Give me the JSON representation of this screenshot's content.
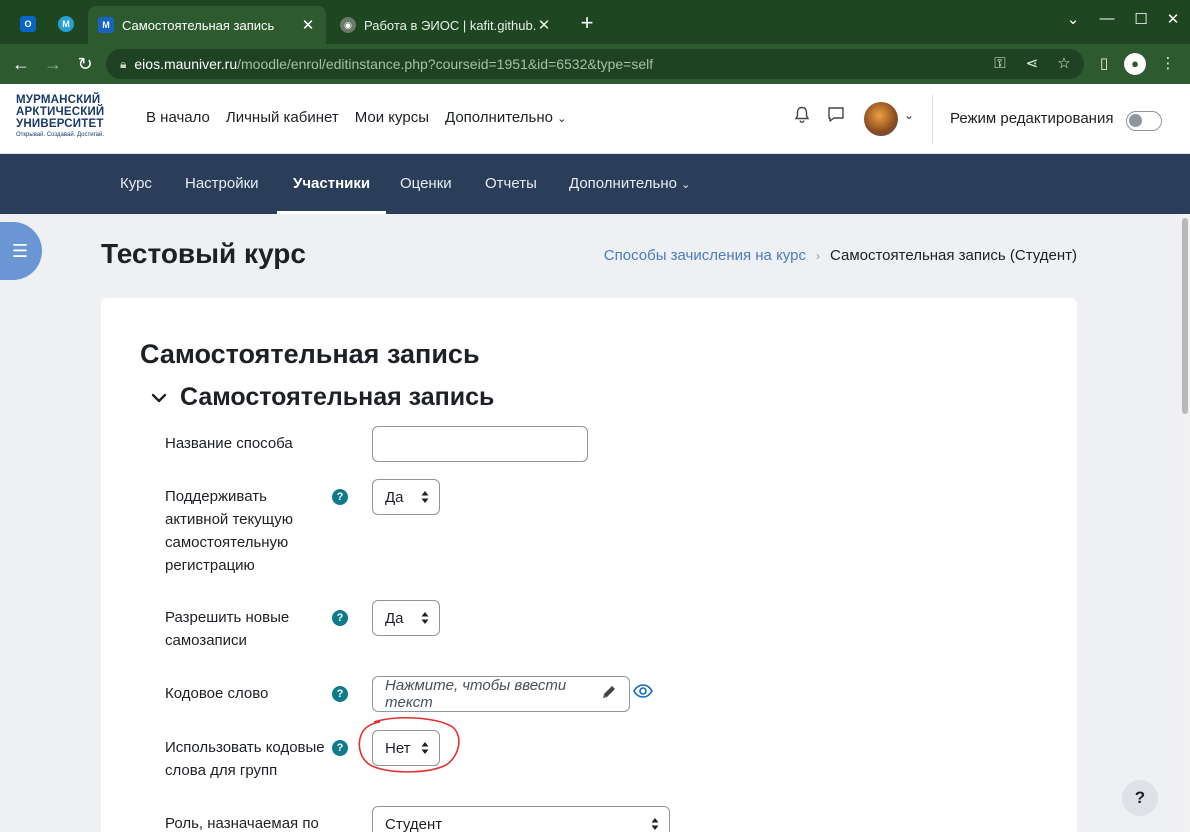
{
  "browser": {
    "tabs": [
      {
        "title": "Самостоятельная запись",
        "active": true
      },
      {
        "title": "Работа в ЭИОС | kafit.github.io",
        "active": false
      }
    ],
    "url_host": "eios.mauniver.ru",
    "url_path": "/moodle/enrol/editinstance.php?courseid=1951&id=6532&type=self",
    "colors": {
      "frame": "#1e4620",
      "toolbar": "#2d5a2e"
    }
  },
  "header": {
    "logo_line1": "МУРМАНСКИЙ",
    "logo_line2": "АРКТИЧЕСКИЙ",
    "logo_line3": "УНИВЕРСИТЕТ",
    "logo_tagline": "Открывай. Создавай. Достигай.",
    "nav": [
      "В начало",
      "Личный кабинет",
      "Мои курсы",
      "Дополнительно"
    ],
    "edit_mode_label": "Режим редактирования",
    "edit_mode_on": false
  },
  "secondary_nav": {
    "items": [
      "Курс",
      "Настройки",
      "Участники",
      "Оценки",
      "Отчеты",
      "Дополнительно"
    ],
    "active": "Участники"
  },
  "page": {
    "course_title": "Тестовый курс",
    "breadcrumb_link": "Способы зачисления на курс",
    "breadcrumb_current": "Самостоятельная запись (Студент)",
    "form_title": "Самостоятельная запись",
    "section_title": "Самостоятельная запись"
  },
  "form": {
    "method_name": {
      "label": "Название способа",
      "value": ""
    },
    "keep_active": {
      "label_lines": [
        "Поддерживать",
        "активной текущую",
        "самостоятельную",
        "регистрацию"
      ],
      "value": "Да"
    },
    "allow_new": {
      "label_lines": [
        "Разрешить новые",
        "самозаписи"
      ],
      "value": "Да"
    },
    "enrol_key": {
      "label": "Кодовое слово",
      "placeholder": "Нажмите, чтобы ввести текст"
    },
    "group_key": {
      "label_lines": [
        "Использовать кодовые",
        "слова для групп"
      ],
      "value": "Нет"
    },
    "role": {
      "label": "Роль, назначаемая по",
      "value": "Студент"
    }
  },
  "help_button": "?",
  "icons": [
    "outlook-icon",
    "moodle-icon",
    "globe-icon",
    "bell-icon",
    "chat-icon",
    "eye-icon",
    "pencil-icon",
    "list-icon",
    "chevron-down-icon",
    "key-icon",
    "share-icon",
    "star-icon"
  ]
}
